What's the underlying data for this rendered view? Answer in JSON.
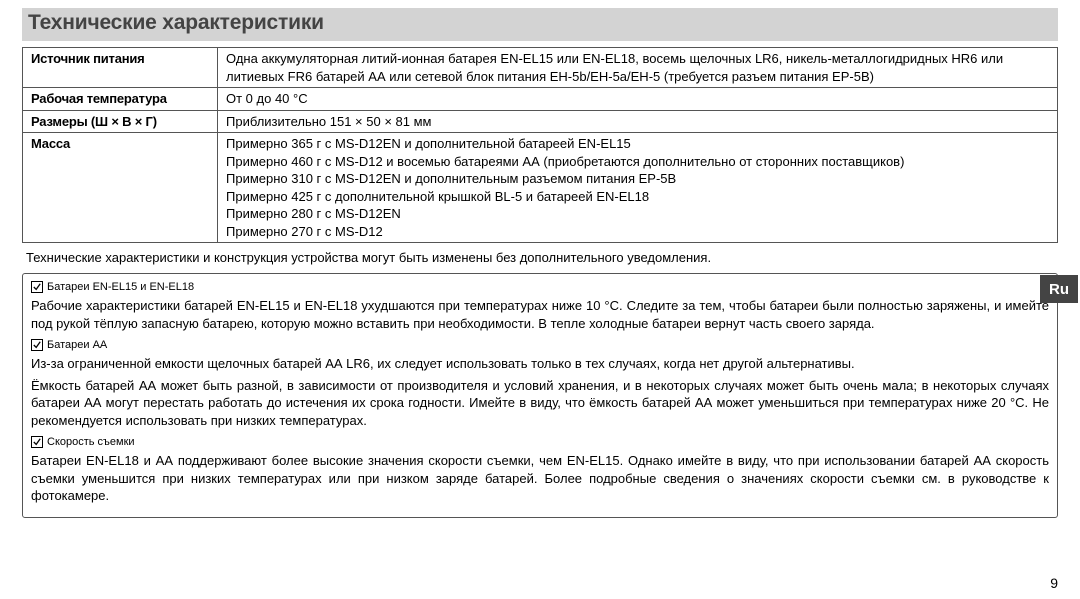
{
  "title": "Технические характеристики",
  "spec_rows": [
    {
      "head": "Источник питания",
      "value": "Одна аккумуляторная литий-ионная батарея EN-EL15 или EN-EL18, восемь щелочных LR6, никель-металлогидридных HR6 или литиевых FR6 батарей АА или сетевой блок питания EH-5b/EH-5a/EH-5 (требуется разъем питания EP-5B)"
    },
    {
      "head": "Рабочая температура",
      "value": "От 0 до 40 °C"
    },
    {
      "head": "Размеры (Ш × В × Г)",
      "value": "Приблизительно 151 × 50 × 81 мм"
    }
  ],
  "mass_head": "Масса",
  "mass_lines": [
    "Примерно 365 г с MS-D12EN и дополнительной батареей EN-EL15",
    "Примерно 460 г с MS-D12 и восемью батареями АА (приобретаются дополнительно от сторонних поставщиков)",
    "Примерно 310 г с MS-D12EN и дополнительным разъемом питания EP-5B",
    "Примерно 425 г с дополнительной крышкой BL-5 и батареей EN-EL18",
    "Примерно 280 г с MS-D12EN",
    "Примерно 270 г с MS-D12"
  ],
  "footnote": "Технические характеристики и конструкция устройства могут быть изменены без дополнительного уведомления.",
  "callout1": "Батареи EN-EL15 и EN-EL18",
  "box_p1": "Рабочие характеристики батарей EN-EL15 и EN-EL18 ухудшаются при температурах ниже 10 °C. Следите за тем, чтобы батареи были полностью заряжены, и имейте под рукой тёплую запасную батарею, которую можно вставить при необходимости. В тепле холодные батареи вернут часть своего заряда.",
  "callout2": "Батареи АА",
  "box_p2": "Из-за ограниченной емкости щелочных батарей АА LR6, их следует использовать только в тех случаях, когда нет другой альтернативы.",
  "box_p3": "Ёмкость батарей АА может быть разной, в зависимости от производителя и условий хранения, и в некоторых случаях может быть очень мала; в некоторых случаях батареи АА могут перестать работать до истечения их срока годности. Имейте в виду, что ёмкость батарей АА может уменьшиться при температурах ниже 20 °C. Не рекомендуется использовать при низких температурах.",
  "callout3": "Скорость съемки",
  "box_p4": "Батареи EN-EL18 и АА поддерживают более высокие значения скорости съемки, чем EN-EL15. Однако имейте в виду, что при использовании батарей АА скорость съемки уменьшится при низких температурах или при низком заряде батарей. Более подробные сведения о значениях скорости съемки см. в руководстве к фотокамере.",
  "lang_tab": "Ru",
  "page_num": "9"
}
